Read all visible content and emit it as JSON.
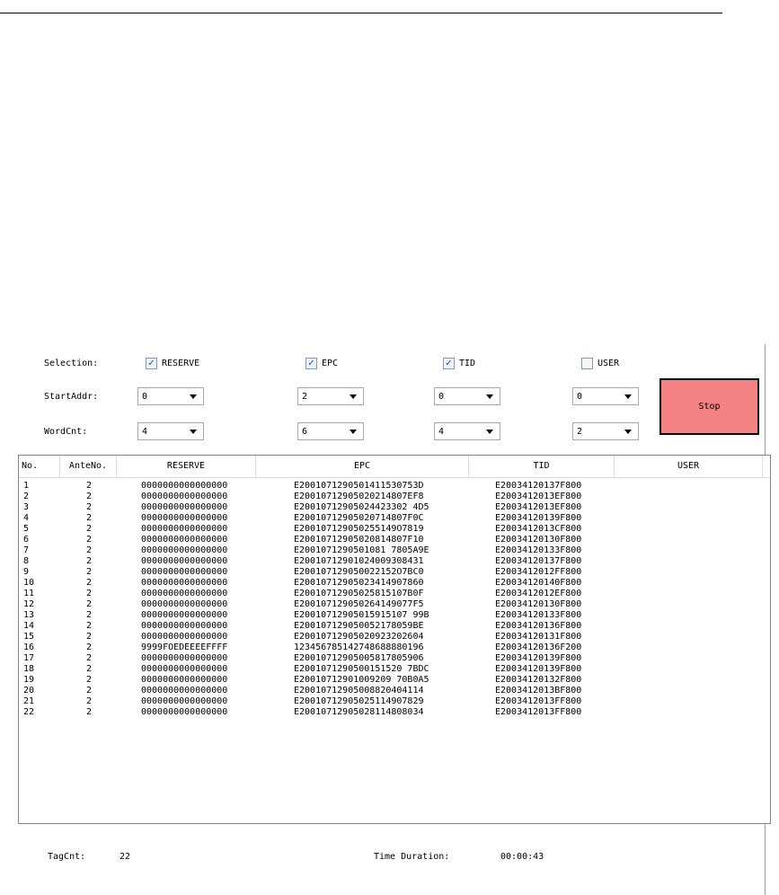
{
  "controls": {
    "selection_label": "Selection:",
    "startaddr_label": "StartAddr:",
    "wordcnt_label": "WordCnt:",
    "checkboxes": [
      {
        "label": "RESERVE",
        "checked": true
      },
      {
        "label": "EPC",
        "checked": true
      },
      {
        "label": "TID",
        "checked": true
      },
      {
        "label": "USER",
        "checked": false
      }
    ],
    "startaddr": [
      "0",
      "2",
      "0",
      "0"
    ],
    "wordcnt": [
      "4",
      "6",
      "4",
      "2"
    ],
    "stop_label": "Stop",
    "stop_color": "#f58282",
    "check_mark": "✓"
  },
  "table": {
    "headers": [
      "No.",
      "AnteNo.",
      "RESERVE",
      "EPC",
      "TID",
      "USER"
    ],
    "rows": [
      {
        "no": "1",
        "ante": "2",
        "reserve": "0000000000000000",
        "epc": "E2001071290501411530753D",
        "tid": "E20034120137F800",
        "user": ""
      },
      {
        "no": "2",
        "ante": "2",
        "reserve": "0000000000000000",
        "epc": "E20010712905020214807EF8",
        "tid": "E2003412013EF800",
        "user": ""
      },
      {
        "no": "3",
        "ante": "2",
        "reserve": "0000000000000000",
        "epc": "E20010712905024423302 4D5",
        "tid": "E2003412013EF800",
        "user": ""
      },
      {
        "no": "4",
        "ante": "2",
        "reserve": "0000000000000000",
        "epc": "E20010712905020714807F0C",
        "tid": "E20034120139F800",
        "user": ""
      },
      {
        "no": "5",
        "ante": "2",
        "reserve": "0000000000000000",
        "epc": "E200107129050255149O7819",
        "tid": "E2003412013CF800",
        "user": ""
      },
      {
        "no": "6",
        "ante": "2",
        "reserve": "0000000000000000",
        "epc": "E20010712905020814807F10",
        "tid": "E20034120130F800",
        "user": ""
      },
      {
        "no": "7",
        "ante": "2",
        "reserve": "0000000000000000",
        "epc": "E2001071290501081 7805A9E",
        "tid": "E20034120133F800",
        "user": ""
      },
      {
        "no": "8",
        "ante": "2",
        "reserve": "0000000000000000",
        "epc": "E20010712901024009308431",
        "tid": "E20034120137F800",
        "user": ""
      },
      {
        "no": "9",
        "ante": "2",
        "reserve": "0000000000000000",
        "epc": "E200107129050022152O7BC0",
        "tid": "E2003412012FF800",
        "user": ""
      },
      {
        "no": "10",
        "ante": "2",
        "reserve": "0000000000000000",
        "epc": "E20010712905023414907860",
        "tid": "E20034120140F800",
        "user": ""
      },
      {
        "no": "11",
        "ante": "2",
        "reserve": "0000000000000000",
        "epc": "E20010712905025815107B0F",
        "tid": "E2003412012EF800",
        "user": ""
      },
      {
        "no": "12",
        "ante": "2",
        "reserve": "0000000000000000",
        "epc": "E200107129050264149077F5",
        "tid": "E20034120130F800",
        "user": ""
      },
      {
        "no": "13",
        "ante": "2",
        "reserve": "0000000000000000",
        "epc": "E20010712905015915107 99B",
        "tid": "E20034120133F800",
        "user": ""
      },
      {
        "no": "14",
        "ante": "2",
        "reserve": "0000000000000000",
        "epc": "E200107129050052178059BE",
        "tid": "E20034120136F800",
        "user": ""
      },
      {
        "no": "15",
        "ante": "2",
        "reserve": "0000000000000000",
        "epc": "E20010712905020923202604",
        "tid": "E20034120131F800",
        "user": ""
      },
      {
        "no": "16",
        "ante": "2",
        "reserve": "9999FOEDEEEEFFFF",
        "epc": "123456785142748688880196",
        "tid": "E20034120136F200",
        "user": ""
      },
      {
        "no": "17",
        "ante": "2",
        "reserve": "0000000000000000",
        "epc": "E20010712905005817805906",
        "tid": "E20034120139F800",
        "user": ""
      },
      {
        "no": "18",
        "ante": "2",
        "reserve": "0000000000000000",
        "epc": "E2001071290500151520 7BDC",
        "tid": "E20034120139F800",
        "user": ""
      },
      {
        "no": "19",
        "ante": "2",
        "reserve": "0000000000000000",
        "epc": "E20010712901009209 70B0A5",
        "tid": "E20034120132F800",
        "user": ""
      },
      {
        "no": "20",
        "ante": "2",
        "reserve": "0000000000000000",
        "epc": "E20010712905008820404114",
        "tid": "E2003412013BF800",
        "user": ""
      },
      {
        "no": "21",
        "ante": "2",
        "reserve": "0000000000000000",
        "epc": "E20010712905025114907829",
        "tid": "E2003412013FF800",
        "user": ""
      },
      {
        "no": "22",
        "ante": "2",
        "reserve": "0000000000000000",
        "epc": "E20010712905028114808034",
        "tid": "E2003412013FF800",
        "user": ""
      }
    ]
  },
  "footer": {
    "tagcnt_label": "TagCnt:",
    "tagcnt_value": "22",
    "duration_label": "Time Duration:",
    "duration_value": "00:00:43"
  }
}
